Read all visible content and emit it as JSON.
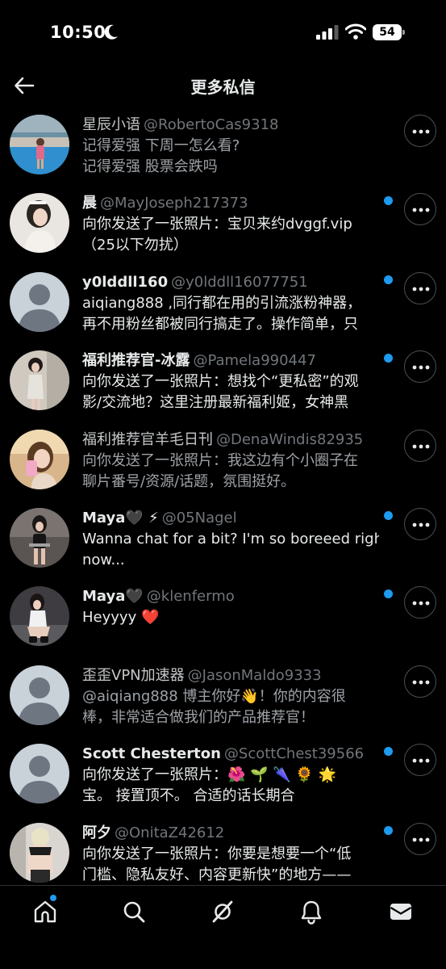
{
  "status_bar": {
    "time": "10:50",
    "battery": "54"
  },
  "header": {
    "title": "更多私信"
  },
  "conversations": [
    {
      "name": "星辰小语",
      "handle": "@RobertoCas9318",
      "preview": [
        "记得爱强  下周一怎么看?",
        "记得爱强    股票会跌吗"
      ],
      "unread": false,
      "muted": true
    },
    {
      "name": "晨",
      "handle": "@MayJoseph217373",
      "preview": [
        "向你发送了一张照片：宝贝来约dvggf.vip",
        "（25以下勿扰）"
      ],
      "unread": true,
      "muted": false
    },
    {
      "name": "y0lddll160",
      "handle": "@y0lddll16077751",
      "preview": [
        "aiqiang888 ,同行都在用的引流涨粉神器，",
        "再不用粉丝都被同行搞走了。操作简单，只"
      ],
      "unread": true,
      "muted": false
    },
    {
      "name": "福利推荐官-冰露",
      "handle": "@Pamela990447",
      "preview": [
        "向你发送了一张照片：想找个“更私密”的观",
        "影/交流地？这里注册最新福利姬，女神黑"
      ],
      "unread": true,
      "muted": false
    },
    {
      "name": "福利推荐官羊毛日刊",
      "handle": "@DenaWindis82935",
      "preview": [
        "向你发送了一张照片：我这边有个小圈子在",
        "聊片番号/资源/话题，氛围挺好。"
      ],
      "unread": false,
      "muted": true
    },
    {
      "name": "Maya🖤 ⚡",
      "handle": "@05Nagel",
      "preview": [
        "Wanna chat for a bit? I'm so boreeed right",
        "now..."
      ],
      "unread": true,
      "muted": false
    },
    {
      "name": "Maya🖤",
      "handle": "@klenfermo",
      "preview": [
        "Heyyyy ❤️"
      ],
      "unread": true,
      "muted": false
    },
    {
      "name": "歪歪VPN加速器",
      "handle": "@JasonMaldo9333",
      "preview": [
        "@aiqiang888 博主你好👋！你的内容很",
        "棒，非常适合做我们的产品推荐官！"
      ],
      "unread": false,
      "muted": true
    },
    {
      "name": "Scott Chesterton",
      "handle": "@ScottChest39566",
      "preview": [
        "向你发送了一张照片：🌺 🌱 🌂 🌻 🌟",
        "宝。 接置顶不。 合适的话长期合"
      ],
      "unread": true,
      "muted": false
    },
    {
      "name": "阿夕",
      "handle": "@OnitaZ42612",
      "preview": [
        "向你发送了一张照片：你要是想要一个“低",
        "门槛、隐私友好、内容更新快”的地方——"
      ],
      "unread": true,
      "muted": false
    }
  ],
  "avatars": [
    "photo-pool",
    "photo-woman-white",
    "default-silhouette",
    "photo-woman-mirror",
    "photo-selfie",
    "photo-woman-stool",
    "photo-woman-crouch",
    "default-silhouette",
    "default-silhouette",
    "photo-woman-back"
  ],
  "tabs": [
    {
      "name": "home",
      "has_badge": true
    },
    {
      "name": "search",
      "has_badge": false
    },
    {
      "name": "grok",
      "has_badge": false
    },
    {
      "name": "notifications",
      "has_badge": false
    },
    {
      "name": "messages",
      "has_badge": false
    }
  ],
  "colors": {
    "accent": "#1d9bf0",
    "background": "#000000",
    "text": "#e7e9ea",
    "secondary": "#71767b"
  }
}
